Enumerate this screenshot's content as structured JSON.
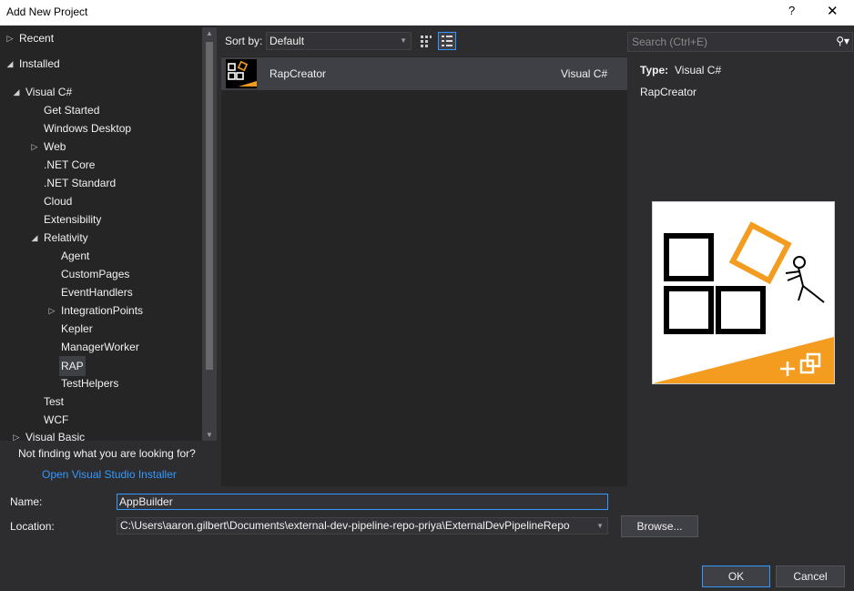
{
  "window": {
    "title": "Add New Project",
    "help_glyph": "?",
    "close_glyph": "✕"
  },
  "tree": {
    "items": [
      {
        "label": "Recent",
        "arrow": "▷"
      },
      {
        "label": "Installed",
        "arrow": "◢"
      },
      {
        "label": "Visual C#",
        "arrow": "◢"
      },
      {
        "label": "Get Started",
        "arrow": ""
      },
      {
        "label": "Windows Desktop",
        "arrow": ""
      },
      {
        "label": "Web",
        "arrow": "▷"
      },
      {
        "label": ".NET Core",
        "arrow": ""
      },
      {
        "label": ".NET Standard",
        "arrow": ""
      },
      {
        "label": "Cloud",
        "arrow": ""
      },
      {
        "label": "Extensibility",
        "arrow": ""
      },
      {
        "label": "Relativity",
        "arrow": "◢"
      },
      {
        "label": "Agent",
        "arrow": ""
      },
      {
        "label": "CustomPages",
        "arrow": ""
      },
      {
        "label": "EventHandlers",
        "arrow": ""
      },
      {
        "label": "IntegrationPoints",
        "arrow": "▷"
      },
      {
        "label": "Kepler",
        "arrow": ""
      },
      {
        "label": "ManagerWorker",
        "arrow": ""
      },
      {
        "label": "RAP",
        "arrow": ""
      },
      {
        "label": "TestHelpers",
        "arrow": ""
      },
      {
        "label": "Test",
        "arrow": ""
      },
      {
        "label": "WCF",
        "arrow": ""
      },
      {
        "label": "Visual Basic",
        "arrow": "▷"
      }
    ],
    "selected": "RAP"
  },
  "help": {
    "not_finding": "Not finding what you are looking for?",
    "installer_link": "Open Visual Studio Installer"
  },
  "toolbar": {
    "sort_label": "Sort by:",
    "sort_value": "Default"
  },
  "search": {
    "placeholder": "Search (Ctrl+E)"
  },
  "templates": [
    {
      "name": "RapCreator",
      "language": "Visual C#"
    }
  ],
  "details": {
    "type_label": "Type:",
    "type_value": "Visual C#",
    "name": "RapCreator"
  },
  "form": {
    "name_label": "Name:",
    "name_value": "AppBuilder",
    "location_label": "Location:",
    "location_value": "C:\\Users\\aaron.gilbert\\Documents\\external-dev-pipeline-repo-priya\\ExternalDevPipelineRepo",
    "browse_label": "Browse...",
    "ok_label": "OK",
    "cancel_label": "Cancel"
  },
  "colors": {
    "accent": "#3399ff",
    "background": "#2d2d30",
    "panel": "#252526",
    "preview_orange": "#f39c1f"
  }
}
